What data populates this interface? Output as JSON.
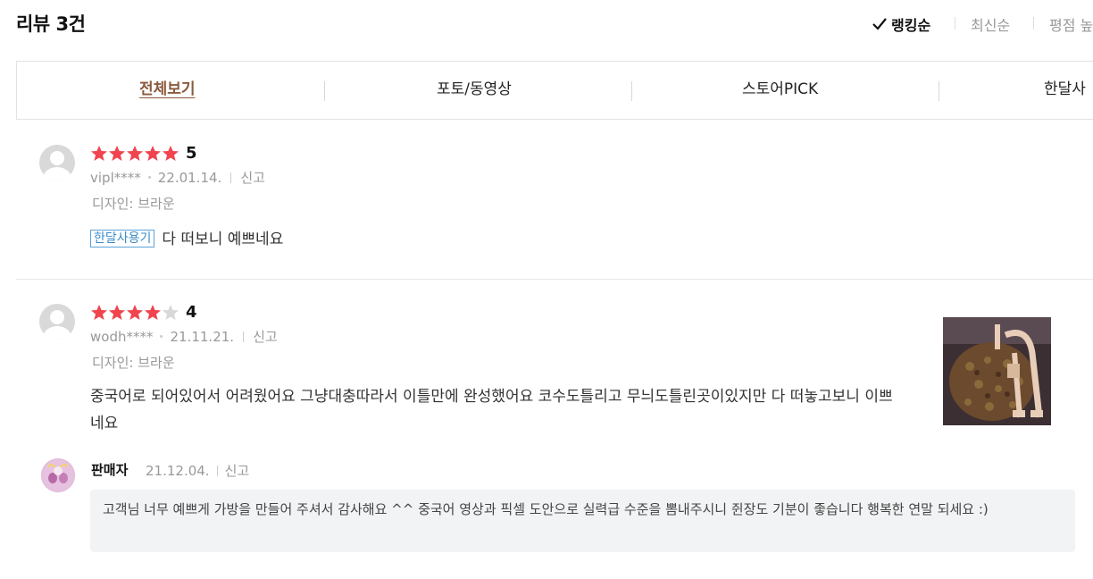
{
  "header": {
    "title": "리뷰 3건",
    "sort": [
      {
        "label": "랭킹순",
        "active": true
      },
      {
        "label": "최신순",
        "active": false
      },
      {
        "label": "평점 높",
        "active": false
      }
    ]
  },
  "tabs": [
    {
      "label": "전체보기",
      "active": true
    },
    {
      "label": "포토/동영상",
      "active": false
    },
    {
      "label": "스토어PICK",
      "active": false
    },
    {
      "label": "한달사",
      "active": false
    }
  ],
  "reviews": [
    {
      "rating": "5",
      "user": "vipl****",
      "date": "22.01.14.",
      "report": "신고",
      "option": "디자인: 브라운",
      "badge": "한달사용기",
      "text": "다 떠보니 예쁘네요"
    },
    {
      "rating": "4",
      "user": "wodh****",
      "date": "21.11.21.",
      "report": "신고",
      "option": "디자인: 브라운",
      "text": "중국어로 되어있어서 어려웠어요 그냥대충따라서 이틀만에 완성했어요 코수도틀리고 무늬도틀린곳이있지만 다 떠놓고보니 이쁘네요",
      "image": "knitted-bag-photo"
    }
  ],
  "seller_reply": {
    "name": "판매자",
    "date": "21.12.04.",
    "report": "신고",
    "text": "고객님 너무 예쁘게 가방을 만들어 주셔서 감사해요 ^^ 중국어 영상과 픽셀 도안으로 실력급 수준을 뽐내주시니 쥔장도 기분이 좋습니다 행복한 연말 되세요 :)"
  },
  "colors": {
    "star": "#f0444f",
    "star_empty": "#d8d8d8",
    "active_tab": "#8a5a3c",
    "badge": "#3a8cc8"
  }
}
